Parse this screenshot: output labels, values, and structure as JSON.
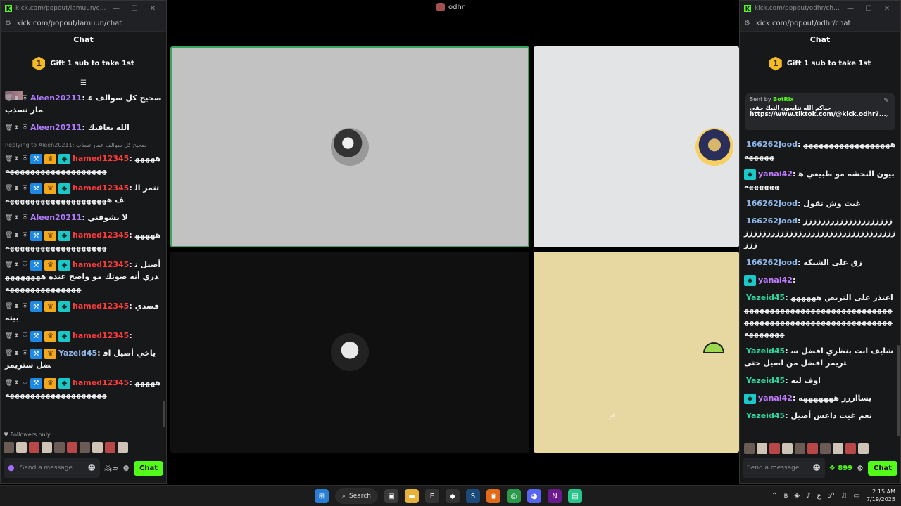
{
  "call": {
    "title": "odhr"
  },
  "left_window": {
    "title": "kick.com/popout/lamuun/chat - G...",
    "url": "kick.com/popout/lamuun/chat",
    "chat_label": "Chat",
    "gift_text": "Gift 1 sub to take 1st",
    "gift_rank": "1",
    "followers_only": "Followers only",
    "input_placeholder": "Send a message",
    "chat_button": "Chat",
    "messages": [
      {
        "user": "Aleen20211",
        "text": "صحيح كل سوالف عمار تسذب",
        "color": "#b07cff",
        "badges": []
      },
      {
        "user": "Aleen20211",
        "text": "الله يعافيك",
        "color": "#b07cff",
        "badges": []
      },
      {
        "reply": "Replying to Aleen20211: صحيح كل سوالف عمار تسذب",
        "user": "hamed12345",
        "text": "ههههههههههههههههههههههههه",
        "color": "#ff3b3b",
        "badges": [
          "blue",
          "gold",
          "teal"
        ]
      },
      {
        "user": "hamed12345",
        "text": "تتمر الف ههههههههههههههههههههه",
        "color": "#ff3b3b",
        "badges": [
          "blue",
          "gold",
          "teal"
        ]
      },
      {
        "user": "Aleen20211",
        "text": "لا يشوفني",
        "color": "#b07cff",
        "badges": []
      },
      {
        "user": "hamed12345",
        "text": "ههههههههههههههههههههههههه",
        "color": "#ff3b3b",
        "badges": [
          "blue",
          "gold",
          "teal"
        ]
      },
      {
        "user": "hamed12345",
        "text": "أصيل تدري أنه صوتك مو واضح عنده ههههههههههههههههههههههه",
        "color": "#ff3b3b",
        "badges": [
          "blue",
          "gold",
          "teal"
        ]
      },
      {
        "user": "hamed12345",
        "text": "قصدي بيته",
        "color": "#ff3b3b",
        "badges": [
          "blue",
          "gold",
          "teal"
        ]
      },
      {
        "user": "hamed12345",
        "text": "",
        "color": "#ff3b3b",
        "badges": [
          "blue",
          "gold",
          "teal"
        ]
      },
      {
        "user": "Yazeid45",
        "text": "ياخي أصيل افضل ستريمر",
        "color": "#8fb6e8",
        "badges": [
          "blue",
          "gold"
        ]
      },
      {
        "user": "hamed12345",
        "text": "ههههههههههههههههههههههههه",
        "color": "#ff3b3b",
        "badges": [
          "blue",
          "gold",
          "teal"
        ]
      }
    ]
  },
  "right_window": {
    "title": "kick.com/popout/odhr/chat - G...",
    "url": "kick.com/popout/odhr/chat",
    "chat_label": "Chat",
    "gift_text": "Gift 1 sub to take 1st",
    "gift_rank": "1",
    "pinned": {
      "sent_by": "Sent by",
      "bot": "BotRix",
      "text": "حياكم الله تتابعون التيك حقي",
      "link": "https://www.tiktok.com/@kick.odhr?..."
    },
    "input_placeholder": "Send a message",
    "kicks": "899",
    "chat_button": "Chat",
    "messages": [
      {
        "user": "166262Jood",
        "text": "هههههههههههههههههههههههه",
        "color": "#8fb6e8",
        "badges": []
      },
      {
        "user": "yanai42",
        "text": "بيون النحشه مو طبيعي هههههههه",
        "color": "#c07bff",
        "badges": [
          "teal"
        ]
      },
      {
        "user": "166262Jood",
        "text": "غيث وش تقول",
        "color": "#8fb6e8",
        "badges": []
      },
      {
        "user": "166262Jood",
        "text": "ززززززززززززززززززززززززززززززززززززززززززززززززززززززززز",
        "color": "#8fb6e8",
        "badges": []
      },
      {
        "user": "166262Jood",
        "text": "زق على الشبكه",
        "color": "#8fb6e8",
        "badges": []
      },
      {
        "user": "yanai42",
        "text": "",
        "color": "#c07bff",
        "badges": [
          "teal"
        ]
      },
      {
        "user": "Yazeid45",
        "text": "اعتذر على التربص هههههههههههههههههههههههههههههههههههههههههههههههههههههههههههههههههههههههه",
        "color": "#2ed8a0",
        "badges": []
      },
      {
        "user": "Yazeid45",
        "text": "شايف انت بنظري افضل ستريمر افضل من اصيل حتى",
        "color": "#2ed8a0",
        "badges": []
      },
      {
        "user": "Yazeid45",
        "text": "اوف ليه",
        "color": "#2ed8a0",
        "badges": []
      },
      {
        "user": "yanai42",
        "text": "يسااررر هههههههه",
        "color": "#c07bff",
        "badges": [
          "teal"
        ]
      },
      {
        "user": "Yazeid45",
        "text": "نعم غيث داعس أصيل",
        "color": "#2ed8a0",
        "badges": []
      }
    ]
  },
  "taskbar": {
    "search_label": "Search",
    "time": "2:15 AM",
    "date": "7/19/2025",
    "lang": "ع"
  }
}
